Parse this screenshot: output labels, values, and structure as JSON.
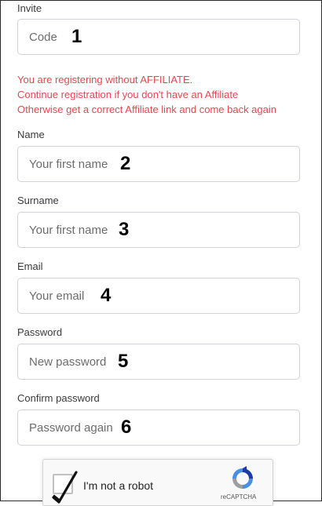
{
  "invite": {
    "label": "Invite",
    "placeholder": "Code",
    "marker": "1"
  },
  "warning": {
    "line1": "You are registering without AFFILIATE.",
    "line2": "Continue registration if you don't have an Affiliate",
    "line3": "Otherwise get a correct Affiliate link and come back again"
  },
  "name": {
    "label": "Name",
    "placeholder": "Your first name",
    "marker": "2"
  },
  "surname": {
    "label": "Surname",
    "placeholder": "Your first name",
    "marker": "3"
  },
  "email": {
    "label": "Email",
    "placeholder": "Your email",
    "marker": "4"
  },
  "password": {
    "label": "Password",
    "placeholder": "New password",
    "marker": "5"
  },
  "confirm": {
    "label": "Confirm password",
    "placeholder": "Password again",
    "marker": "6"
  },
  "captcha": {
    "label": "I'm not a robot",
    "brand": "reCAPTCHA",
    "checked": true,
    "check_icon": "checkmark-icon",
    "logo_icon": "recaptcha-logo-icon"
  },
  "colors": {
    "warning": "#e5484d",
    "border": "#cfd3d7"
  }
}
